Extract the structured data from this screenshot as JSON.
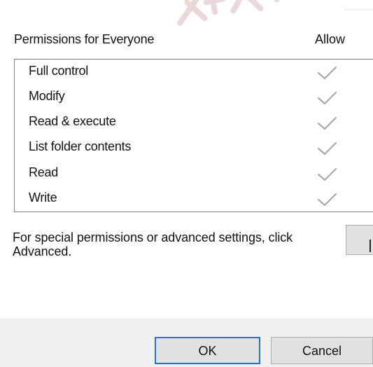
{
  "header": {
    "title": "Permissions for Everyone",
    "column_allow": "Allow"
  },
  "permissions": [
    {
      "label": "Full control",
      "allow": true
    },
    {
      "label": "Modify",
      "allow": true
    },
    {
      "label": "Read & execute",
      "allow": true
    },
    {
      "label": "List folder contents",
      "allow": true
    },
    {
      "label": "Read",
      "allow": true
    },
    {
      "label": "Write",
      "allow": true
    }
  ],
  "advanced": {
    "text": "For special permissions or advanced settings, click Advanced."
  },
  "dialog": {
    "ok_label": "OK",
    "cancel_label": "Cancel"
  },
  "icons": {
    "check": "check-icon"
  },
  "colors": {
    "checkmark": "#a9a9a9",
    "list_border": "#7f7f7f",
    "button_background": "#e1e1e1",
    "button_border": "#adadad",
    "default_button_border": "#1b74d9",
    "footer_background": "#f0f0f0",
    "watermark": "#ead8d8"
  }
}
